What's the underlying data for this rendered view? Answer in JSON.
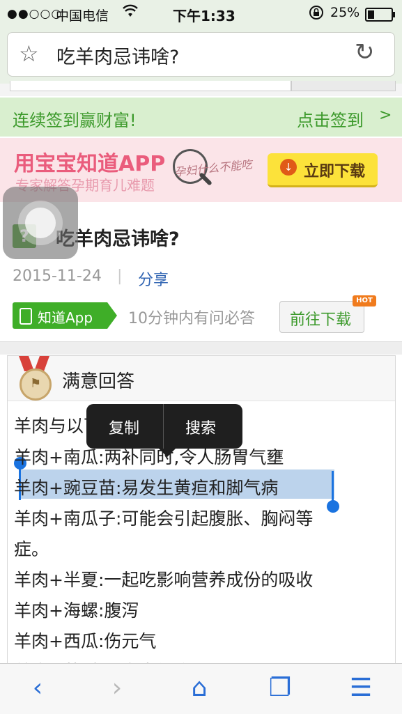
{
  "status_bar": {
    "signal": "●●○○○",
    "carrier": "中国电信",
    "time": "下午1:33",
    "battery": "25%"
  },
  "address_bar": {
    "title": "吃羊肉忌讳啥?"
  },
  "signin_bar": {
    "left_text": "连续签到赢财富!",
    "right_text": "点击签到",
    "arrow": ">"
  },
  "banner": {
    "title": "用宝宝知道APP",
    "subtitle": "专家解答孕期育儿难题",
    "handwriting": "孕妇什么不能吃",
    "download_label": "立即下载"
  },
  "question": {
    "title": "吃羊肉忌讳啥?",
    "date": "2015-11-24",
    "separator": "|",
    "share_label": "分享",
    "app_badge": "知道App",
    "promise": "10分钟内有问必答",
    "go_download": "前往下载",
    "hot_badge": "HOT"
  },
  "answer": {
    "header": "满意回答",
    "lines": [
      "羊肉与以下食物不宜一起吃:",
      "羊肉+南瓜:两补同时,令人肠胃气壅",
      "羊肉+豌豆苗:易发生黄疸和脚气病",
      "羊肉+南瓜子:可能会引起腹胀、胸闷等",
      "症。",
      "羊肉+半夏:一起吃影响营养成份的吸收",
      "羊肉+海螺:腹泻",
      "羊肉+西瓜:伤元气",
      "羊肉+茶:容易发生便秘"
    ]
  },
  "selection_popup": {
    "copy": "复制",
    "search": "搜索"
  },
  "toolbar": {
    "back": "‹",
    "forward": "›",
    "home": "⌂",
    "tabs": "❐",
    "menu": "☰"
  },
  "colors": {
    "accent_green": "#3d9a2c",
    "link_blue": "#3366b3",
    "selection": "#bcd3ec",
    "ios_blue": "#2a6ed6"
  }
}
